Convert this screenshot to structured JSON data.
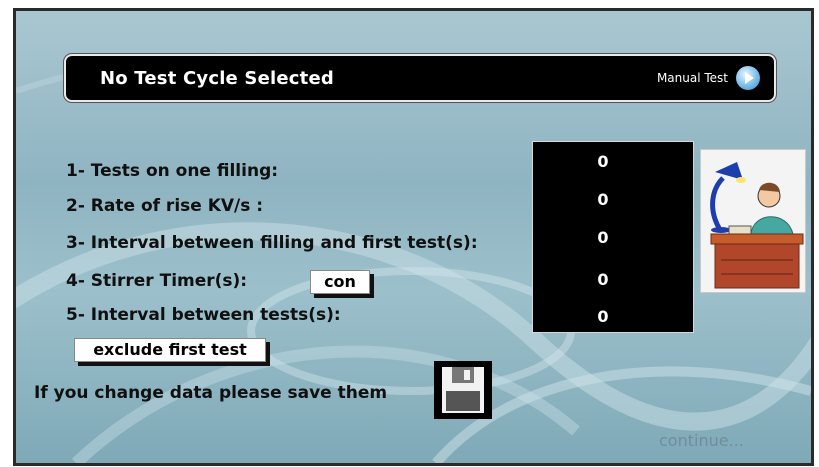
{
  "header": {
    "title": "No Test Cycle Selected",
    "mode_label": "Manual Test",
    "mode_icon": "play-icon"
  },
  "settings": [
    {
      "label": "1- Tests on one filling:",
      "value": "0"
    },
    {
      "label": "2- Rate of rise KV/s :",
      "value": "0"
    },
    {
      "label": "3- Interval between filling and first test(s):",
      "value": "0"
    },
    {
      "label": "4- Stirrer Timer(s):",
      "value": "0"
    },
    {
      "label": "5- Interval between tests(s):",
      "value": "0"
    }
  ],
  "buttons": {
    "stirrer": "con",
    "exclude": "exclude first test"
  },
  "footer": {
    "save_hint": "If you change data please save them",
    "save_icon": "floppy-disk-icon",
    "continue": "continue..."
  },
  "illustration": "person-at-desk-with-lamp"
}
